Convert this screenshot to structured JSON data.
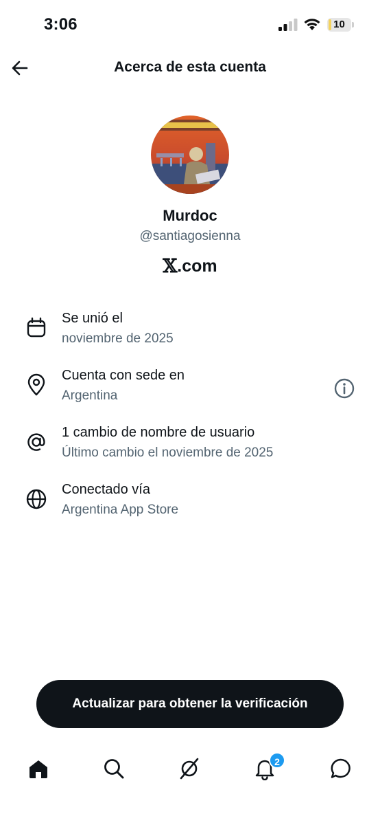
{
  "status_bar": {
    "time": "3:06",
    "battery_level": "10",
    "battery_fraction": 0.1,
    "signal_icon": "cellular-signal-icon",
    "wifi_icon": "wifi-icon"
  },
  "header": {
    "title": "Acerca de esta cuenta",
    "back_icon": "arrow-left-icon"
  },
  "profile": {
    "display_name": "Murdoc",
    "handle": "@santiagosienna",
    "site_logo": "𝕏",
    "site_text": ".com"
  },
  "info_items": [
    {
      "icon": "calendar-icon",
      "label": "Se unió el",
      "value": "noviembre de 2025"
    },
    {
      "icon": "location-pin-icon",
      "label": "Cuenta con sede en",
      "value": "Argentina",
      "action_icon": "info-icon"
    },
    {
      "icon": "at-sign-icon",
      "label": "1 cambio de nombre de usuario",
      "value": "Último cambio el noviembre de 2025"
    },
    {
      "icon": "globe-icon",
      "label": "Conectado vía",
      "value": "Argentina App Store"
    }
  ],
  "cta": {
    "label": "Actualizar para obtener la verificación"
  },
  "bottom_nav": {
    "items": [
      "home-icon",
      "search-icon",
      "grok-icon",
      "notifications-bell-icon",
      "messages-icon"
    ],
    "notification_count": "2",
    "accent_color": "#1d9bf0"
  },
  "colors": {
    "text_primary": "#0f1419",
    "text_secondary": "#536471",
    "badge": "#1d9bf0"
  }
}
